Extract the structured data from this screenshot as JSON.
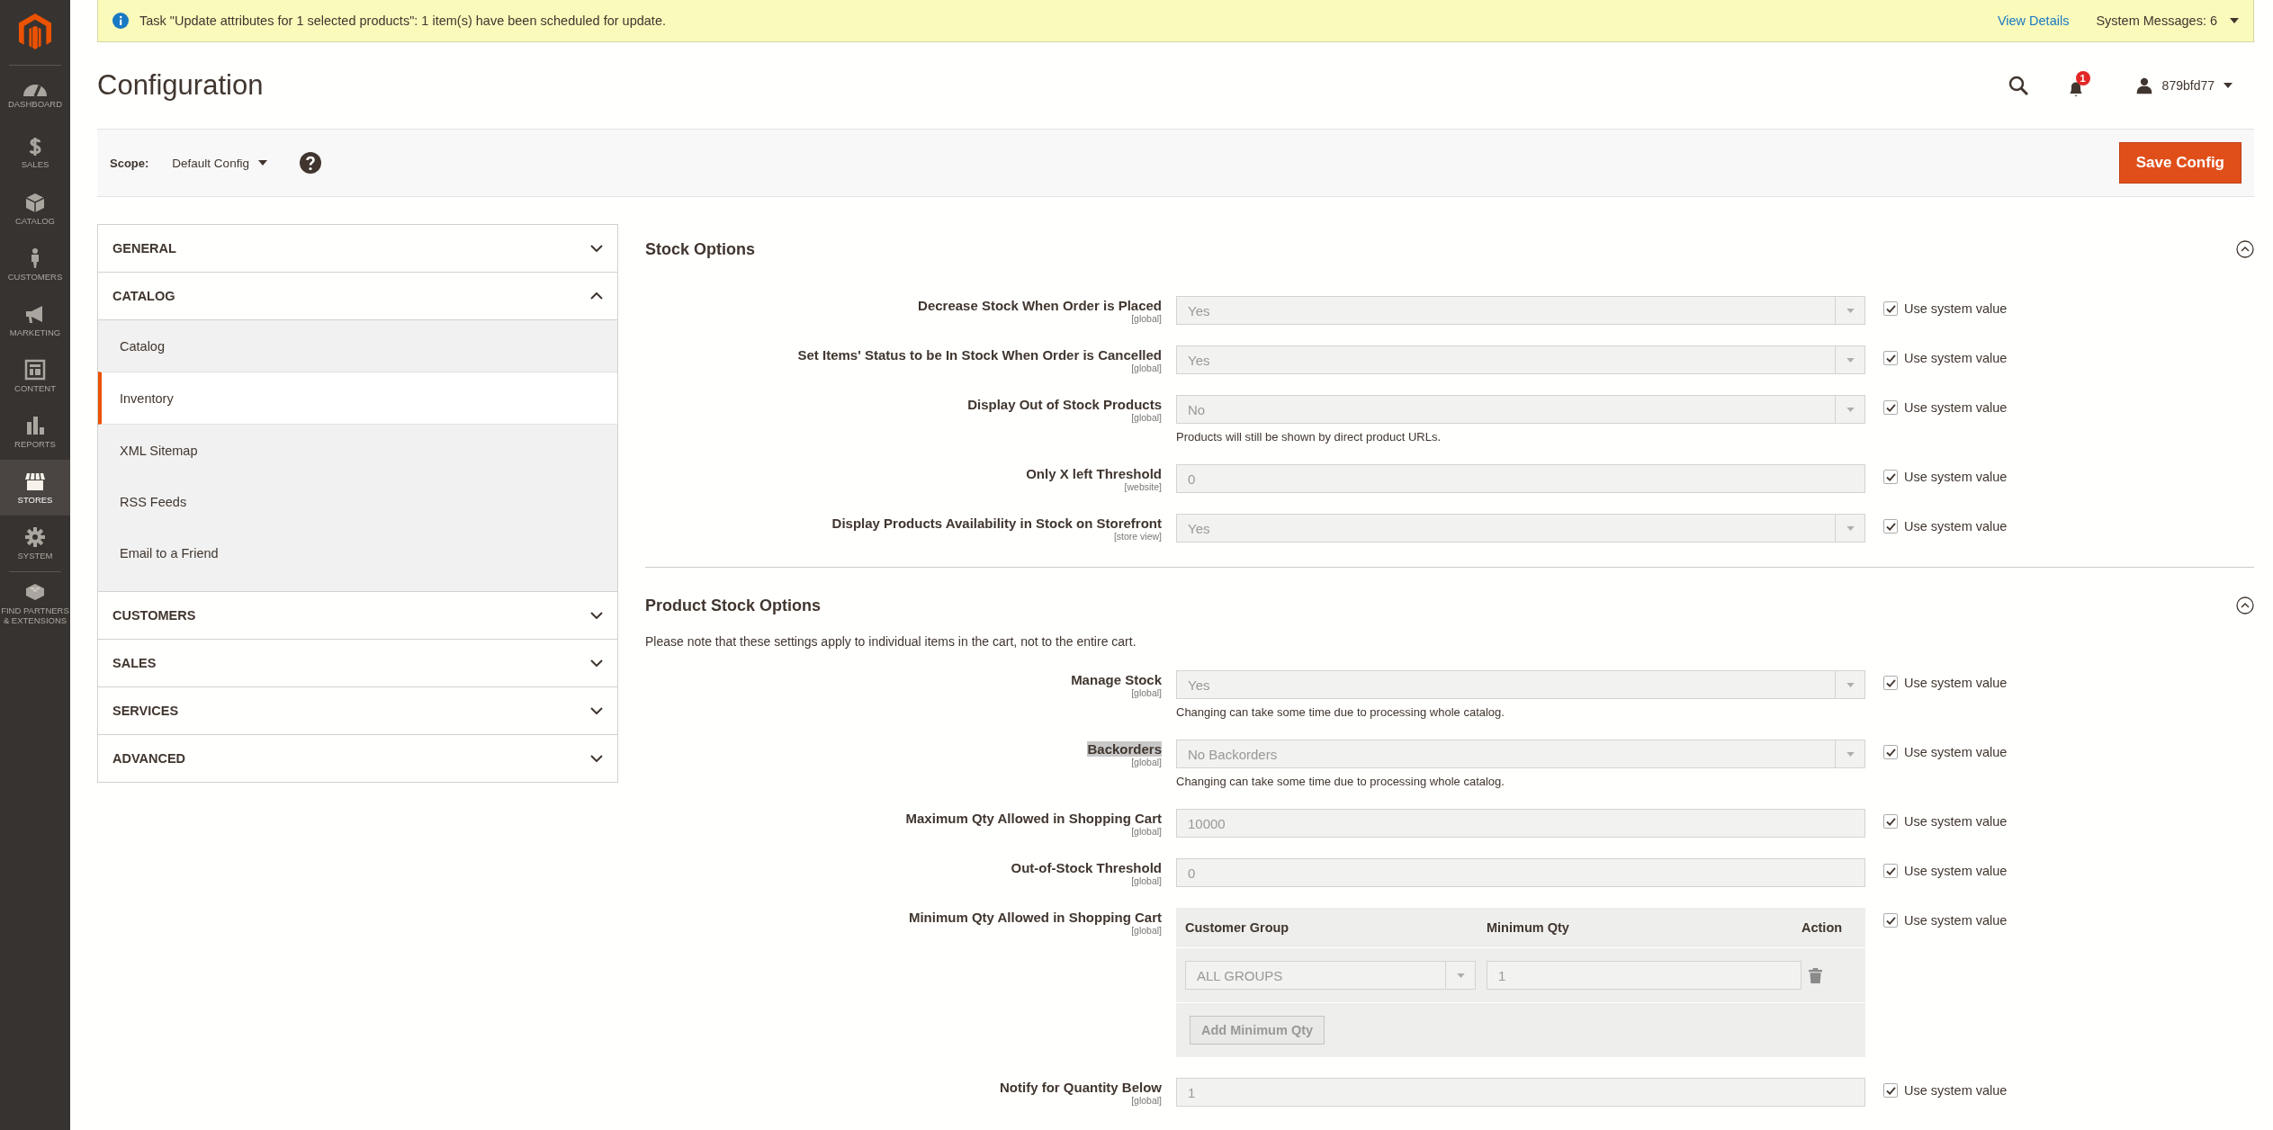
{
  "sidebar": {
    "items": [
      {
        "label": "DASHBOARD",
        "kind": "dashboard",
        "selected": false
      },
      {
        "label": "SALES",
        "kind": "sales",
        "selected": false
      },
      {
        "label": "CATALOG",
        "kind": "catalog",
        "selected": false
      },
      {
        "label": "CUSTOMERS",
        "kind": "customers",
        "selected": false
      },
      {
        "label": "MARKETING",
        "kind": "marketing",
        "selected": false
      },
      {
        "label": "CONTENT",
        "kind": "content",
        "selected": false
      },
      {
        "label": "REPORTS",
        "kind": "reports",
        "selected": false
      },
      {
        "label": "STORES",
        "kind": "stores",
        "selected": true
      },
      {
        "label": "SYSTEM",
        "kind": "system",
        "selected": false
      },
      {
        "label": "FIND PARTNERS & EXTENSIONS",
        "kind": "extensions",
        "selected": false
      }
    ]
  },
  "notice": {
    "message": "Task \"Update attributes for 1 selected products\": 1 item(s) have been scheduled for update.",
    "link": "View Details",
    "system_messages": "System Messages: 6"
  },
  "header": {
    "title": "Configuration",
    "notification_count": "1",
    "user": "879bfd77"
  },
  "scope_bar": {
    "label": "Scope:",
    "value": "Default Config",
    "save_button": "Save Config"
  },
  "nav": [
    {
      "label": "GENERAL",
      "expanded": false
    },
    {
      "label": "CATALOG",
      "expanded": true,
      "children": [
        {
          "label": "Catalog",
          "selected": false
        },
        {
          "label": "Inventory",
          "selected": true
        },
        {
          "label": "XML Sitemap",
          "selected": false
        },
        {
          "label": "RSS Feeds",
          "selected": false
        },
        {
          "label": "Email to a Friend",
          "selected": false
        }
      ]
    },
    {
      "label": "CUSTOMERS",
      "expanded": false
    },
    {
      "label": "SALES",
      "expanded": false
    },
    {
      "label": "SERVICES",
      "expanded": false
    },
    {
      "label": "ADVANCED",
      "expanded": false
    }
  ],
  "sections": [
    {
      "title": "Stock Options",
      "expanded": true,
      "fields": [
        {
          "label": "Decrease Stock When Order is Placed",
          "scope": "[global]",
          "kind": "select",
          "value": "Yes",
          "use_system_value": true,
          "use_system_label": "Use system value",
          "highlighted": false
        },
        {
          "label": "Set Items' Status to be In Stock When Order is Cancelled",
          "scope": "[global]",
          "kind": "select",
          "value": "Yes",
          "use_system_value": true,
          "use_system_label": "Use system value",
          "highlighted": false
        },
        {
          "label": "Display Out of Stock Products",
          "scope": "[global]",
          "kind": "select",
          "value": "No",
          "comment": "Products will still be shown by direct product URLs.",
          "use_system_value": true,
          "use_system_label": "Use system value",
          "highlighted": false
        },
        {
          "label": "Only X left Threshold",
          "scope": "[website]",
          "kind": "text",
          "value": "0",
          "use_system_value": true,
          "use_system_label": "Use system value",
          "highlighted": false
        },
        {
          "label": "Display Products Availability in Stock on Storefront",
          "scope": "[store view]",
          "kind": "select",
          "value": "Yes",
          "use_system_value": true,
          "use_system_label": "Use system value",
          "highlighted": false
        }
      ]
    },
    {
      "title": "Product Stock Options",
      "expanded": true,
      "note": "Please note that these settings apply to individual items in the cart, not to the entire cart.",
      "fields": [
        {
          "label": "Manage Stock",
          "scope": "[global]",
          "kind": "select",
          "value": "Yes",
          "comment": "Changing can take some time due to processing whole catalog.",
          "use_system_value": true,
          "use_system_label": "Use system value",
          "highlighted": false
        },
        {
          "label": "Backorders",
          "scope": "[global]",
          "kind": "select",
          "value": "No Backorders",
          "comment": "Changing can take some time due to processing whole catalog.",
          "use_system_value": true,
          "use_system_label": "Use system value",
          "highlighted": true
        },
        {
          "label": "Maximum Qty Allowed in Shopping Cart",
          "scope": "[global]",
          "kind": "text",
          "value": "10000",
          "use_system_value": true,
          "use_system_label": "Use system value",
          "highlighted": false
        },
        {
          "label": "Out-of-Stock Threshold",
          "scope": "[global]",
          "kind": "text",
          "value": "0",
          "use_system_value": true,
          "use_system_label": "Use system value",
          "highlighted": false
        },
        {
          "label": "Minimum Qty Allowed in Shopping Cart",
          "scope": "[global]",
          "kind": "table",
          "columns": [
            "Customer Group",
            "Minimum Qty",
            "Action"
          ],
          "rows": [
            {
              "group": "ALL GROUPS",
              "qty": "1"
            }
          ],
          "add_button": "Add Minimum Qty",
          "use_system_value": true,
          "use_system_label": "Use system value",
          "highlighted": false
        },
        {
          "label": "Notify for Quantity Below",
          "scope": "[global]",
          "kind": "text",
          "value": "1",
          "use_system_value": true,
          "use_system_label": "Use system value",
          "highlighted": false
        }
      ]
    }
  ]
}
